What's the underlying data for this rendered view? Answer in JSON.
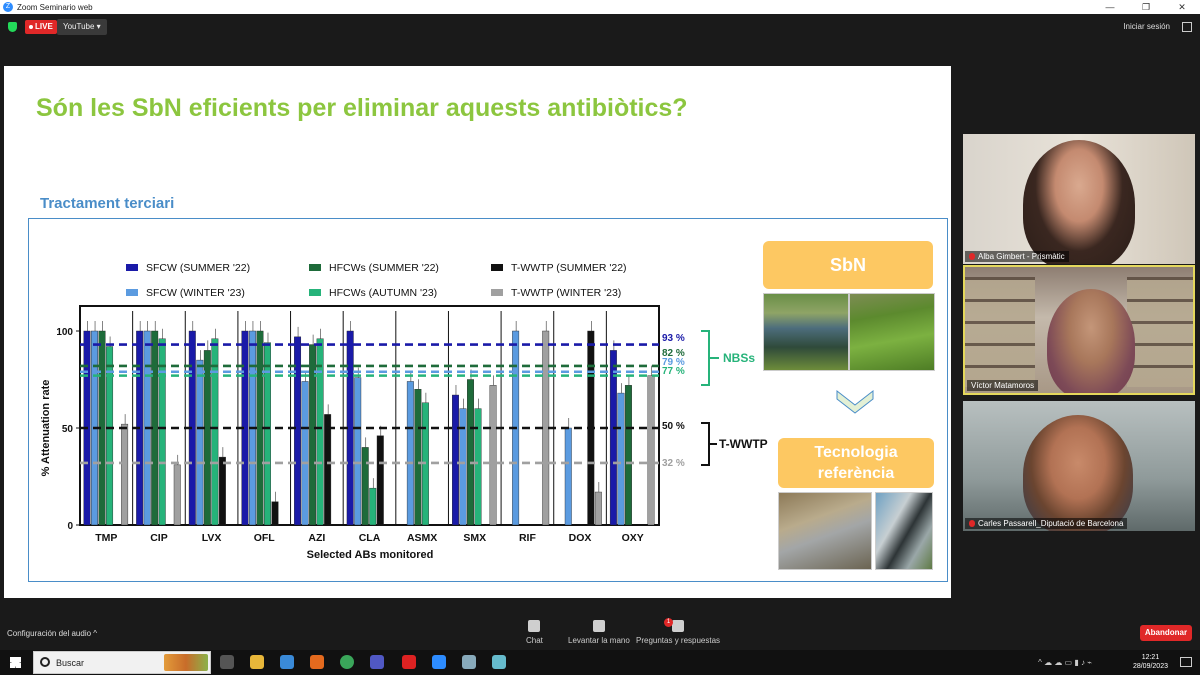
{
  "window": {
    "title": "Zoom Seminario web",
    "controls": [
      "—",
      "❐",
      "✕"
    ]
  },
  "topbar": {
    "live_label": "LIVE",
    "stream_label": "YouTube ▾",
    "signin_label": "Iniciar sesión"
  },
  "slide": {
    "title": "Són les SbN eficients per eliminar aquests antibiòtics?",
    "subheading": "Tractament terciari",
    "sbn_label": "SbN",
    "tech_label_1": "Tecnologia",
    "tech_label_2": "referència",
    "colors": {
      "title": "#8cc63f",
      "accent": "#4a8dc8",
      "orange": "#fdc862"
    }
  },
  "chart_data": {
    "type": "bar",
    "xlabel": "Selected ABs monitored",
    "ylabel": "% Attenuation rate",
    "ylim": [
      0,
      100
    ],
    "yticks": [
      0,
      50,
      100
    ],
    "categories": [
      "TMP",
      "CIP",
      "LVX",
      "OFL",
      "AZI",
      "CLA",
      "ASMX",
      "SMX",
      "RIF",
      "DOX",
      "OXY"
    ],
    "series": [
      {
        "name": "SFCW (SUMMER '22)",
        "color": "#1a1aa8",
        "values": [
          100,
          100,
          100,
          100,
          97,
          100,
          0,
          67,
          0,
          0,
          90
        ]
      },
      {
        "name": "SFCW (WINTER '23)",
        "color": "#5b9be0",
        "values": [
          100,
          100,
          85,
          100,
          74,
          76,
          74,
          60,
          100,
          50,
          68
        ]
      },
      {
        "name": "HFCWs (SUMMER '22)",
        "color": "#1e6b3a",
        "values": [
          100,
          100,
          90,
          100,
          93,
          40,
          70,
          75,
          0,
          0,
          72
        ]
      },
      {
        "name": "HFCWs (AUTUMN '23)",
        "color": "#26b37a",
        "values": [
          92,
          96,
          96,
          94,
          96,
          19,
          63,
          60,
          0,
          0,
          0
        ]
      },
      {
        "name": "T-WWTP (SUMMER '22)",
        "color": "#111111",
        "values": [
          0,
          0,
          35,
          12,
          57,
          46,
          0,
          0,
          0,
          100,
          0
        ]
      },
      {
        "name": "T-WWTP (WINTER '23)",
        "color": "#a0a0a0",
        "values": [
          52,
          31,
          0,
          0,
          0,
          0,
          0,
          72,
          100,
          17,
          77
        ]
      }
    ],
    "reference_lines": [
      {
        "value": 93,
        "label": "93 %",
        "color": "#1a1aa8"
      },
      {
        "value": 82,
        "label": "82 %",
        "color": "#1e6b3a"
      },
      {
        "value": 79,
        "label": "79 %",
        "color": "#5b9be0"
      },
      {
        "value": 77,
        "label": "77 %",
        "color": "#26b37a"
      },
      {
        "value": 50,
        "label": "50 %",
        "color": "#111111"
      },
      {
        "value": 32,
        "label": "32 %",
        "color": "#a0a0a0"
      }
    ],
    "bracket_labels": {
      "nbs": "NBSs",
      "wwtp": "T-WWTP"
    }
  },
  "participants": [
    {
      "name": "Alba Gimbert - Prismàtic",
      "muted": true
    },
    {
      "name": "Víctor Matamoros",
      "muted": false
    },
    {
      "name": "Carles Passarell_Diputació de Barcelona",
      "muted": true
    }
  ],
  "bottombar": {
    "audio_label": "Configuración del audio",
    "chat_label": "Chat",
    "hand_label": "Levantar la mano",
    "qa_label": "Preguntas y respuestas",
    "qa_badge": "1",
    "leave_label": "Abandonar"
  },
  "taskbar": {
    "search_placeholder": "Buscar",
    "time": "12:21",
    "date": "28/09/2023"
  }
}
